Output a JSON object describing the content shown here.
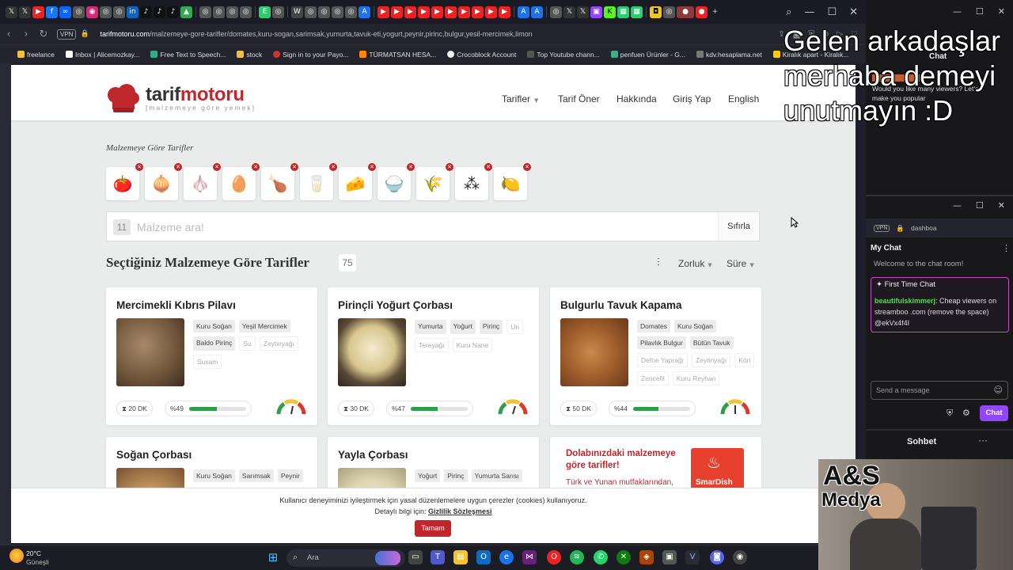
{
  "browser": {
    "url_domain": "tarifmotoru.com",
    "url_path": "/malzemeye-gore-tarifler/domates,kuru-sogan,sarimsak,yumurta,tavuk-eti,yogurt,peynir,pirinc,bulgur,yesil-mercimek,limon",
    "vpn_label": "VPN",
    "bookmarks": [
      "freelance",
      "Inbox | Alicemozkay...",
      "Free Text to Speech...",
      "stock",
      "Sign in to your Payo...",
      "TÜRMATSAN HESA...",
      "Crocoblock Account",
      "Top Youtube chann...",
      "penfuen Ürünler - G...",
      "kdv.hesaplama.net",
      "Kiralık apart - Kiralık..."
    ]
  },
  "site": {
    "logo_part1": "tarif",
    "logo_part2": "motoru",
    "logo_tagline": "[malzemeye göre yemek]",
    "nav": {
      "recipes": "Tarifler",
      "suggest": "Tarif Öner",
      "about": "Hakkında",
      "login": "Giriş Yap",
      "lang": "English"
    },
    "page_subtitle": "Malzemeye Göre Tarifler",
    "ingredients": [
      "tomato-icon",
      "onion-icon",
      "garlic-icon",
      "egg-icon",
      "chicken-icon",
      "yogurt-icon",
      "cheese-icon",
      "rice-icon",
      "bulgur-icon",
      "lentil-icon",
      "lemon-icon"
    ],
    "search": {
      "count": "11",
      "placeholder": "Malzeme ara!",
      "reset": "Sıfırla"
    },
    "results": {
      "title": "Seçtiğiniz Malzemeye Göre Tarifler",
      "count": "75",
      "sort_difficulty": "Zorluk",
      "sort_time": "Süre"
    },
    "recipes": [
      {
        "title": "Mercimekli Kıbrıs Pilavı",
        "tags": [
          "Kuru Soğan",
          "Yeşil Mercimek",
          "Baldo Pirinç"
        ],
        "missing": [
          "Su",
          "Zeytinyağı",
          "Susam"
        ],
        "time": "20 DK",
        "match_label": "%49",
        "match": 0.49
      },
      {
        "title": "Pirinçli Yoğurt Çorbası",
        "tags": [
          "Yumurta",
          "Yoğurt",
          "Pirinç"
        ],
        "missing": [
          "Un",
          "Tereyağı",
          "Kuru Nane"
        ],
        "time": "30 DK",
        "match_label": "%47",
        "match": 0.47
      },
      {
        "title": "Bulgurlu Tavuk Kapama",
        "tags": [
          "Domates",
          "Kuru Soğan",
          "Pilavlık Bulgur",
          "Bütün Tavuk"
        ],
        "missing": [
          "Defne Yaprağı",
          "Zeytinyağı",
          "Köri",
          "Zencefil",
          "Kuru Reyhan"
        ],
        "time": "50 DK",
        "match_label": "%44",
        "match": 0.44
      },
      {
        "title": "Soğan Çorbası",
        "tags": [
          "Kuru Soğan",
          "Sarımsak",
          "Peynir"
        ],
        "missing": []
      },
      {
        "title": "Yayla Çorbası",
        "tags": [
          "Yoğurt",
          "Pirinç",
          "Yumurta Sarısı"
        ],
        "missing": []
      }
    ],
    "promo": {
      "title": "Dolabınızdaki malzemeye göre tarifler!",
      "text": "Türk ve Yunan mutfaklarından,",
      "brand": "SmarDish"
    },
    "cookie": {
      "line1": "Kullanıcı deneyiminizi iyileştirmek için yasal düzenlemelere uygun çerezler (cookies) kullanıyoruz.",
      "line2_prefix": "Detaylı bilgi için:",
      "line2_link": "Gizlilik Sözleşmesi",
      "accept": "Tamam"
    }
  },
  "stream": {
    "overlay_lines": [
      "Gelen arkadaşlar",
      "merhaba demeyi",
      "unutmayın :D"
    ],
    "chat_label": "Chat",
    "chat_msg": "Would you like many viewers? Let's make you popular",
    "dash_label": "dashboa",
    "my_chat": "My Chat",
    "welcome": "Welcome to the chat room!",
    "first_time_chat": "First Time Chat",
    "spam_user": "beautifulskimmerj",
    "spam_text": ": Cheap viewers on streamboo .com (remove the space) @ekVx4f4I",
    "send_placeholder": "Send a message",
    "chat_btn": "Chat",
    "sohbet": "Sohbet",
    "brand1": "A&S",
    "brand2": "Medya"
  },
  "taskbar": {
    "weather_temp": "20°C",
    "weather_desc": "Güneşli",
    "search_label": "Ara"
  }
}
